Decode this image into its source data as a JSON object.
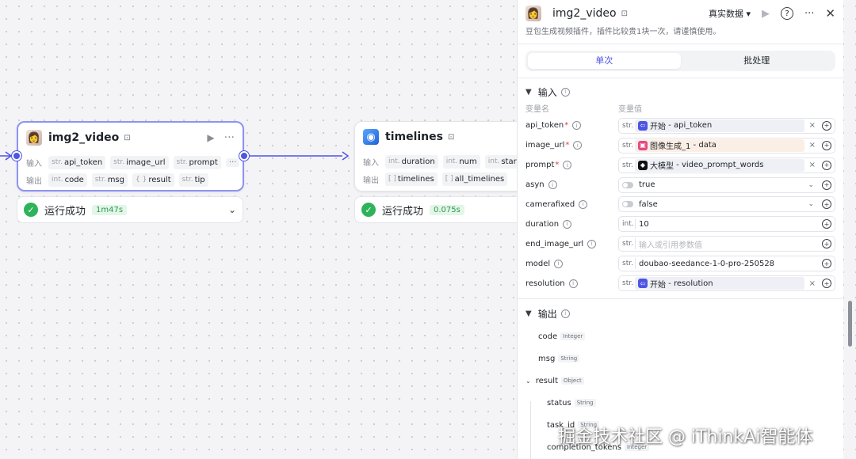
{
  "canvas": {
    "node1": {
      "title": "img2_video",
      "badge": "⊡",
      "input_label": "输入",
      "output_label": "输出",
      "inputs": [
        {
          "type": "str.",
          "name": "api_token"
        },
        {
          "type": "str.",
          "name": "image_url"
        },
        {
          "type": "str.",
          "name": "prompt"
        }
      ],
      "more": "···",
      "outputs": [
        {
          "type": "int.",
          "name": "code"
        },
        {
          "type": "str.",
          "name": "msg"
        },
        {
          "type": "{ }",
          "name": "result"
        },
        {
          "type": "str.",
          "name": "tip"
        }
      ],
      "status": "运行成功",
      "time": "1m47s"
    },
    "node2": {
      "title": "timelines",
      "badge": "⊡",
      "input_label": "输入",
      "output_label": "输出",
      "inputs": [
        {
          "type": "int.",
          "name": "duration"
        },
        {
          "type": "int.",
          "name": "num"
        },
        {
          "type": "int.",
          "name": "start"
        },
        {
          "type": "int.",
          "name": ""
        }
      ],
      "outputs": [
        {
          "type": "[ ]",
          "name": "timelines"
        },
        {
          "type": "[ ]",
          "name": "all_timelines"
        }
      ],
      "status": "运行成功",
      "time": "0.075s"
    }
  },
  "panel": {
    "title": "img2_video",
    "badge": "⊡",
    "mode": "真实数据",
    "description": "豆包生成视频插件，插件比较贵1块一次，请谨慎使用。",
    "tabs": [
      {
        "label": "单次"
      },
      {
        "label": "批处理"
      }
    ],
    "input_section": "输入",
    "col_name": "变量名",
    "col_value": "变量值",
    "params": [
      {
        "name": "api_token",
        "required": "*",
        "type": "str.",
        "ref_src": "开始",
        "ref_var": "api_token"
      },
      {
        "name": "image_url",
        "required": "*",
        "type": "str.",
        "ref_src": "图像生成_1",
        "ref_var": "data"
      },
      {
        "name": "prompt",
        "required": "*",
        "type": "str.",
        "ref_src": "大模型",
        "ref_var": "video_prompt_words"
      },
      {
        "name": "asyn",
        "value": "true"
      },
      {
        "name": "camerafixed",
        "value": "false"
      },
      {
        "name": "duration",
        "type": "int.",
        "value": "10"
      },
      {
        "name": "end_image_url",
        "type": "str.",
        "placeholder": "输入或引用参数值"
      },
      {
        "name": "model",
        "type": "str.",
        "value": "doubao-seedance-1-0-pro-250528"
      },
      {
        "name": "resolution",
        "type": "str.",
        "ref_src": "开始",
        "ref_var": "resolution"
      }
    ],
    "output_section": "输出",
    "outputs": [
      {
        "name": "code",
        "type": "Integer"
      },
      {
        "name": "msg",
        "type": "String"
      },
      {
        "name": "result",
        "type": "Object"
      },
      {
        "name": "status",
        "type": "String"
      },
      {
        "name": "task_id",
        "type": "String"
      },
      {
        "name": "completion_tokens",
        "type": "Integer"
      }
    ]
  },
  "watermark": "掘金技术社区 @ iThinkAi智能体",
  "colors": {
    "accent": "#4e55e3",
    "success": "#2fb35a",
    "required": "#e53d3d"
  }
}
